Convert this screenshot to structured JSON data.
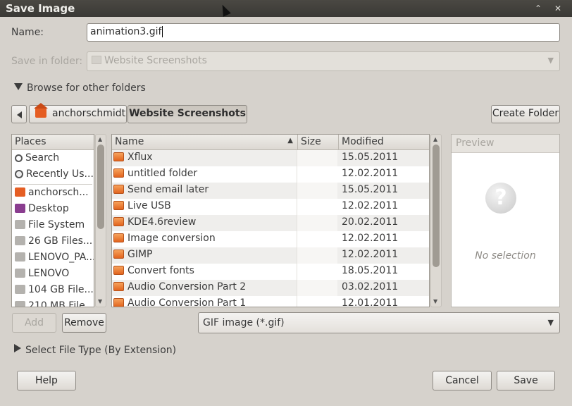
{
  "window": {
    "title": "Save Image"
  },
  "name_field": {
    "label": "Name:",
    "value": "animation3.gif"
  },
  "save_in_folder": {
    "label": "Save in folder:",
    "value": "Website Screenshots"
  },
  "browse_expander": {
    "label": "Browse for other folders"
  },
  "pathbar": {
    "segments": [
      "anchorschmidt",
      "Website Screenshots"
    ],
    "create_folder_label": "Create Folder"
  },
  "places": {
    "header": "Places",
    "items": [
      {
        "label": "Search",
        "icon": "search-icon"
      },
      {
        "label": "Recently Us...",
        "icon": "recent-icon"
      },
      {
        "label": "anchorsch...",
        "icon": "home-icon"
      },
      {
        "label": "Desktop",
        "icon": "desktop-icon"
      },
      {
        "label": "File System",
        "icon": "drive-icon"
      },
      {
        "label": "26 GB Files...",
        "icon": "drive-icon"
      },
      {
        "label": "LENOVO_PA...",
        "icon": "drive-icon"
      },
      {
        "label": "LENOVO",
        "icon": "drive-icon"
      },
      {
        "label": "104 GB File...",
        "icon": "drive-icon"
      },
      {
        "label": "210 MB File...",
        "icon": "drive-icon"
      }
    ],
    "add_label": "Add",
    "remove_label": "Remove"
  },
  "files": {
    "columns": {
      "name": "Name",
      "size": "Size",
      "modified": "Modified"
    },
    "rows": [
      {
        "name": "Xflux",
        "size": "",
        "modified": "15.05.2011"
      },
      {
        "name": "untitled folder",
        "size": "",
        "modified": "12.02.2011"
      },
      {
        "name": "Send email later",
        "size": "",
        "modified": "15.05.2011"
      },
      {
        "name": "Live USB",
        "size": "",
        "modified": "12.02.2011"
      },
      {
        "name": "KDE4.6review",
        "size": "",
        "modified": "20.02.2011"
      },
      {
        "name": "Image conversion",
        "size": "",
        "modified": "12.02.2011"
      },
      {
        "name": "GIMP",
        "size": "",
        "modified": "12.02.2011"
      },
      {
        "name": "Convert fonts",
        "size": "",
        "modified": "18.05.2011"
      },
      {
        "name": "Audio Conversion Part 2",
        "size": "",
        "modified": "03.02.2011"
      },
      {
        "name": "Audio Conversion Part 1",
        "size": "",
        "modified": "12.01.2011"
      }
    ]
  },
  "preview": {
    "header": "Preview",
    "empty_text": "No selection"
  },
  "file_type": {
    "value": "GIF image (*.gif)"
  },
  "select_type_expander": {
    "label": "Select File Type (By Extension)"
  },
  "buttons": {
    "help": "Help",
    "cancel": "Cancel",
    "save": "Save"
  }
}
